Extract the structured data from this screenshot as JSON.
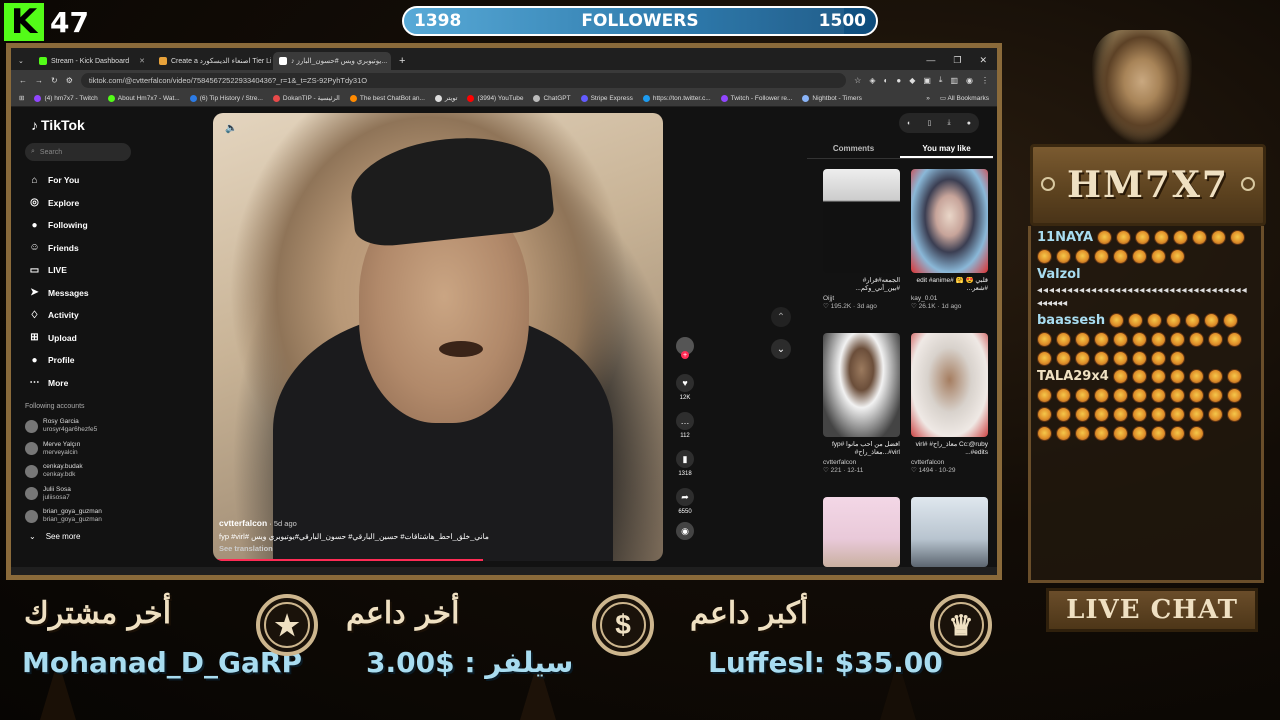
{
  "kick": {
    "logo": "K",
    "viewers": "47"
  },
  "followers": {
    "current": "1398",
    "label": "FOLLOWERS",
    "goal": "1500",
    "progress_fraction": 0.932
  },
  "browser": {
    "tabs": [
      {
        "label": "Stream - Kick Dashboard",
        "active": false,
        "color": "#53fc18"
      },
      {
        "label": "Create a اصنعاء الديسكورد Tier Li",
        "active": false,
        "color": "#e8a23a"
      },
      {
        "label": "♪ يوتيوبري ويس #حسون_البارز...",
        "active": true,
        "color": "#ffffff"
      }
    ],
    "url": "tiktok.com/@cvtterfalcon/video/758456725229334043​6?_r=1&_t=ZS-92PyhTdy31O",
    "bookmarks": [
      {
        "label": "(4) hm7x7 - Twitch",
        "color": "#9146ff"
      },
      {
        "label": "About Hm7x7 - Wat...",
        "color": "#53fc18"
      },
      {
        "label": "(6) Tip History / Stre...",
        "color": "#2c7be5"
      },
      {
        "label": "DokanTIP - الرئيسية",
        "color": "#e84a4a"
      },
      {
        "label": "The best ChatBot an...",
        "color": "#ff8a00"
      },
      {
        "label": "تويتر",
        "color": "#dddddd"
      },
      {
        "label": "(3994) YouTube",
        "color": "#ff0000"
      },
      {
        "label": "ChatGPT",
        "color": "#bbbbbb"
      },
      {
        "label": "Stripe Express",
        "color": "#635bff"
      },
      {
        "label": "https://ton.twitter.c...",
        "color": "#1d9bf0"
      },
      {
        "label": "Twitch - Follower re...",
        "color": "#9146ff"
      },
      {
        "label": "Nightbot - Timers",
        "color": "#8ab4f8"
      }
    ],
    "all_bookmarks": "All Bookmarks"
  },
  "tiktok": {
    "logo": "TikTok",
    "search_placeholder": "Search",
    "nav": [
      {
        "label": "For You",
        "icon": "home-icon",
        "glyph": "⌂"
      },
      {
        "label": "Explore",
        "icon": "compass-icon",
        "glyph": "◎"
      },
      {
        "label": "Following",
        "icon": "following-avatar-icon",
        "glyph": "●"
      },
      {
        "label": "Friends",
        "icon": "friends-icon",
        "glyph": "☺"
      },
      {
        "label": "LIVE",
        "icon": "live-icon",
        "glyph": "▭"
      },
      {
        "label": "Messages",
        "icon": "send-icon",
        "glyph": "➤"
      },
      {
        "label": "Activity",
        "icon": "bell-icon",
        "glyph": "♢"
      },
      {
        "label": "Upload",
        "icon": "plus-box-icon",
        "glyph": "⊞"
      },
      {
        "label": "Profile",
        "icon": "profile-avatar-icon",
        "glyph": "●"
      },
      {
        "label": "More",
        "icon": "more-icon",
        "glyph": "⋯"
      }
    ],
    "following_accounts_title": "Following accounts",
    "accounts": [
      {
        "name": "Rosy Garcia",
        "handle": "urosyr4gar6hezfe5"
      },
      {
        "name": "Merve Yalçın",
        "handle": "merveyalcin"
      },
      {
        "name": "cenkay.budak",
        "handle": "cenkay.bdk"
      },
      {
        "name": "Julii Sosa",
        "handle": "juliisosa7"
      },
      {
        "name": "brian_goya_guzman",
        "handle": "brian_goya_guzman"
      }
    ],
    "see_more": "See more",
    "video": {
      "creator": "cvtterfalcon",
      "date": "5d ago",
      "caption": "ماني_خلق_احط_هاشتاقات# حسين_البارقي# حسون_البارقي#يوتيوبري ويس #fyp #virl",
      "see_translation": "See translation",
      "progress_fraction": 0.6
    },
    "actions": {
      "likes": "12K",
      "comments": "112",
      "saves": "1318",
      "shares": "6550"
    },
    "right_tabs": [
      "Comments",
      "You may like"
    ],
    "cards": [
      {
        "caption": "الجمعه#قرار# #بين_أني_وكم...",
        "user": "Oijjt",
        "likes": "195.2K",
        "date": "3d ago"
      },
      {
        "caption": "قلبي 😍 🤗 #edit #anime #شعر...",
        "user": "kay_0.01",
        "likes": "26.1K",
        "date": "1d ago"
      },
      {
        "caption": "افضل من أحب مانوا #fyp #virl...معاذ_راح#",
        "user": "cvtterfalcon",
        "likes": "221",
        "date": "12-11"
      },
      {
        "caption": "Cc:@ruby معاذ_راح# #virl #edits...",
        "user": "cvtterfalcon",
        "likes": "1494",
        "date": "10-29"
      }
    ]
  },
  "overlay": {
    "channel_name": "HM7X7",
    "live_chat": "LIVE CHAT",
    "last_subscriber_label": "أخر مشترك",
    "last_subscriber": "Mohanad_D_GaRP",
    "last_supporter_label": "أخر داعم",
    "last_supporter": "سيلفر : $3.00",
    "top_supporter_label": "أكبر داعم",
    "top_supporter": "Luffesl: $35.00"
  },
  "chat": [
    {
      "user": "11NAYA",
      "color": "#a8dcf0",
      "emotes": 16
    },
    {
      "user": "Valzol",
      "color": "#a8dcf0",
      "text": "◂◂◂◂◂◂◂◂◂◂◂◂◂◂◂◂◂◂◂◂◂◂◂◂◂◂◂◂◂◂◂◂◂◂◂",
      "text2": "◂◂◂◂◂◂"
    },
    {
      "user": "baassesh",
      "color": "#a8dcf0",
      "emotes": 26
    },
    {
      "user": "TALA29x4",
      "color": "#efe0c2",
      "emotes": 38
    }
  ]
}
